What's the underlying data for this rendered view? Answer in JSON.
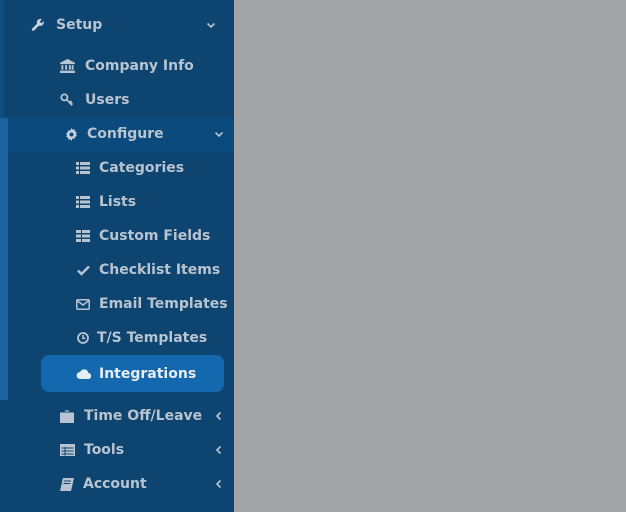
{
  "sidebar": {
    "setup": {
      "label": "Setup",
      "icon": "wrench-icon"
    },
    "setup_items": [
      {
        "label": "Company Info",
        "icon": "bank-icon"
      },
      {
        "label": "Users",
        "icon": "key-icon"
      }
    ],
    "configure": {
      "label": "Configure",
      "icon": "gear-icon"
    },
    "configure_items": [
      {
        "label": "Categories",
        "icon": "list-icon"
      },
      {
        "label": "Lists",
        "icon": "list-icon"
      },
      {
        "label": "Custom Fields",
        "icon": "table-list-icon"
      },
      {
        "label": "Checklist Items",
        "icon": "check-icon"
      },
      {
        "label": "Email Templates",
        "icon": "envelope-icon"
      },
      {
        "label": "T/S Templates",
        "icon": "clock-icon"
      },
      {
        "label": "Integrations",
        "icon": "cloud-icon",
        "active": true
      }
    ],
    "bottom_items": [
      {
        "label": "Time Off/Leave",
        "icon": "briefcase-icon"
      },
      {
        "label": "Tools",
        "icon": "table-icon"
      },
      {
        "label": "Account",
        "icon": "book-icon"
      }
    ]
  },
  "colors": {
    "sidebar_bg": "#0d4470",
    "active_bg": "#1469ae",
    "content_bg": "#a3a4a6",
    "text": "#b8c4d0"
  }
}
